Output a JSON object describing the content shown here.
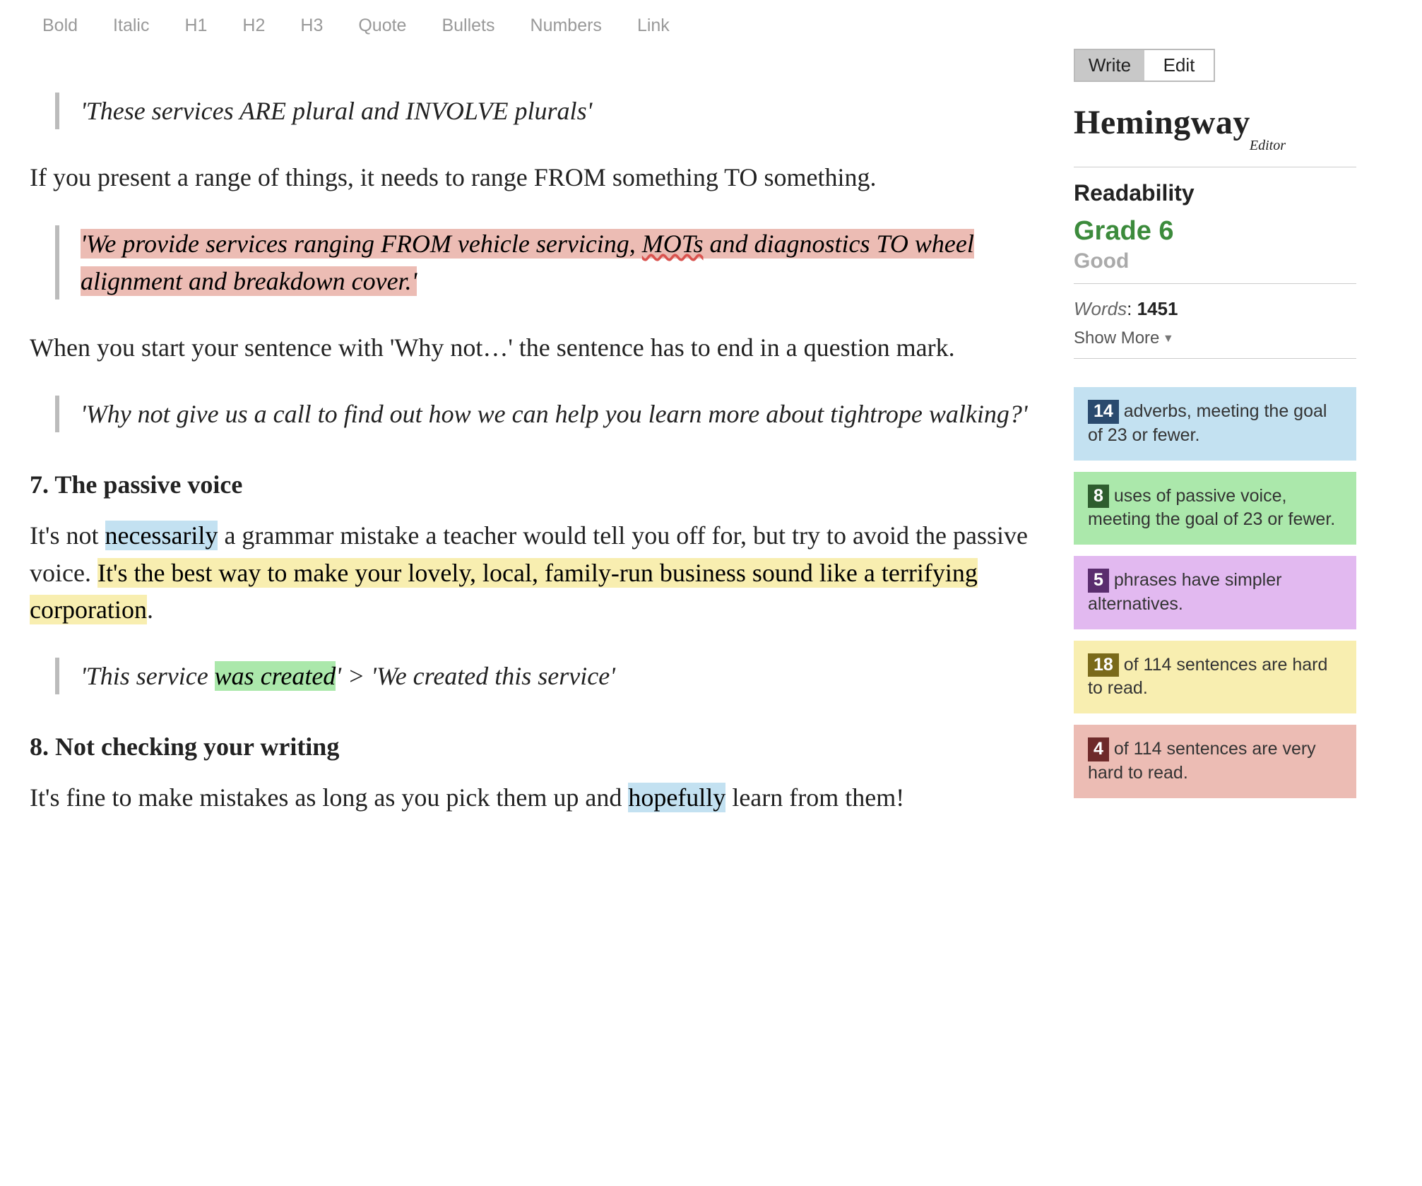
{
  "toolbar": {
    "bold": "Bold",
    "italic": "Italic",
    "h1": "H1",
    "h2": "H2",
    "h3": "H3",
    "quote": "Quote",
    "bullets": "Bullets",
    "numbers": "Numbers",
    "link": "Link"
  },
  "editor": {
    "quote1": "'These services ARE plural and INVOLVE plurals'",
    "para1": "If you present a range of things, it needs to range FROM something TO something.",
    "quote2_part1": "'We provide services ranging FROM vehicle servicing, ",
    "quote2_part2": "MOTs",
    "quote2_part3": " and diagnostics TO wheel alignment and breakdown cover.'",
    "para2": "When you start your sentence with 'Why not…' the sentence has to end in a question mark.",
    "quote3": "'Why not give us a call to find out how we can help you learn more about tightrope walking?'",
    "heading7": "7. The passive voice",
    "para3_a": "It's not ",
    "para3_nec": "necessarily",
    "para3_b": " a grammar mistake a teacher would tell you off for, but try to avoid the passive voice. ",
    "para3_yellow": "It's the best way to make your lovely, local, family-run business sound like a terrifying corporation",
    "para3_c": ".",
    "quote4_a": "'This service ",
    "quote4_green": "was created",
    "quote4_b": "' > 'We created this service'",
    "heading8": "8. Not checking your writing",
    "para4_a": "It's fine to make mistakes as long as you pick them up and ",
    "para4_hope": "hopefully",
    "para4_b": " learn from them!"
  },
  "sidebar": {
    "tabs": {
      "write": "Write",
      "edit": "Edit"
    },
    "logo": "Hemingway",
    "logo_sub": "Editor",
    "readability_label": "Readability",
    "grade": "Grade 6",
    "good": "Good",
    "words_label": "Words",
    "words_value": "1451",
    "show_more": "Show More",
    "stats": {
      "adverbs": {
        "count": "14",
        "text": " adverbs, meeting the goal of 23 or fewer."
      },
      "passive": {
        "count": "8",
        "text": " uses of passive voice, meeting the goal of 23 or fewer."
      },
      "simpler": {
        "count": "5",
        "text": " phrases have simpler alternatives."
      },
      "hard": {
        "count": "18",
        "text": " of 114 sentences are hard to read."
      },
      "vhard": {
        "count": "4",
        "text": " of 114 sentences are very hard to read."
      }
    }
  }
}
